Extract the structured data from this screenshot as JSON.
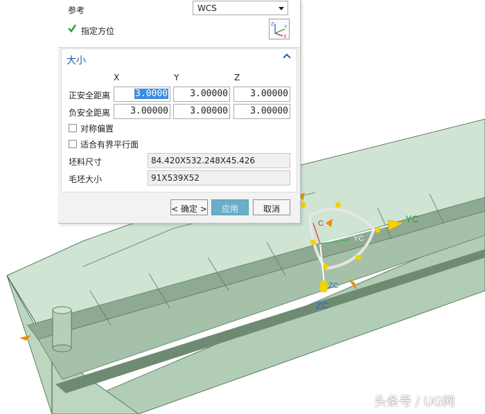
{
  "dialog": {
    "reference_label": "参考",
    "reference_value": "WCS",
    "specify_orientation_label": "指定方位",
    "size_section_title": "大小",
    "columns": [
      "X",
      "Y",
      "Z"
    ],
    "positive_distance_label": "正安全距离",
    "positive_values": [
      "3.0000",
      "3.00000",
      "3.00000"
    ],
    "negative_distance_label": "负安全距离",
    "negative_values": [
      "3.00000",
      "3.00000",
      "3.00000"
    ],
    "symmetric_offset_label": "对称偏置",
    "fit_bounded_plane_label": "适合有界平行面",
    "blank_size_label": "坯料尺寸",
    "blank_size_value": "84.420X532.248X45.426",
    "stock_size_label": "毛坯大小",
    "stock_size_value": "91X539X52",
    "ok_label": "< 确定 >",
    "apply_label": "应用",
    "cancel_label": "取消"
  },
  "csys_icon": {
    "z": "Z",
    "y": "Y",
    "x": "X"
  },
  "viewport": {
    "triad": {
      "yc": "YC",
      "zc": "ZC",
      "zc_small": "ZC",
      "yc_small": "YC",
      "xc_small": "C"
    }
  },
  "watermark": "头条号 / UG网",
  "colors": {
    "model_face": "#c4dcc8",
    "model_edge": "#5b7a62",
    "accent_blue": "#1f5fa8",
    "apply_button": "#6aaec9",
    "check_green": "#2a9d3a",
    "axis_yellow": "#f2d200",
    "axis_orange": "#f08c00"
  }
}
